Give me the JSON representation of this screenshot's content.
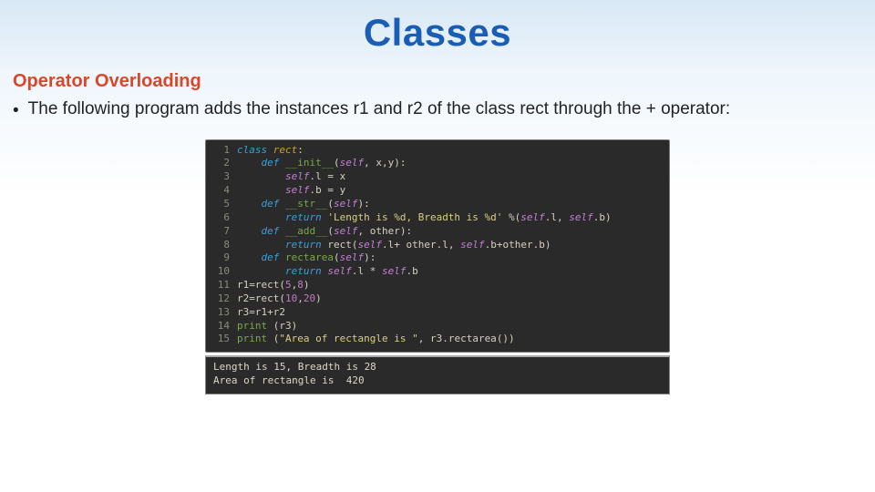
{
  "title": "Classes",
  "subheading": "Operator Overloading",
  "bullet": "The following program adds the instances r1 and r2 of the class rect through the + operator:",
  "code": {
    "lines": [
      {
        "n": "1",
        "tokens": [
          {
            "c": "kw",
            "t": "class"
          },
          {
            "c": "op",
            "t": " "
          },
          {
            "c": "def",
            "t": "rect"
          },
          {
            "c": "op",
            "t": ":"
          }
        ]
      },
      {
        "n": "2",
        "tokens": [
          {
            "c": "op",
            "t": "    "
          },
          {
            "c": "kw",
            "t": "def"
          },
          {
            "c": "op",
            "t": " "
          },
          {
            "c": "fn",
            "t": "__init__"
          },
          {
            "c": "op",
            "t": "("
          },
          {
            "c": "self",
            "t": "self"
          },
          {
            "c": "op",
            "t": ", "
          },
          {
            "c": "id",
            "t": "x"
          },
          {
            "c": "op",
            "t": ","
          },
          {
            "c": "id",
            "t": "y"
          },
          {
            "c": "op",
            "t": "):"
          }
        ]
      },
      {
        "n": "3",
        "tokens": [
          {
            "c": "op",
            "t": "        "
          },
          {
            "c": "self",
            "t": "self"
          },
          {
            "c": "op",
            "t": "."
          },
          {
            "c": "attr",
            "t": "l"
          },
          {
            "c": "op",
            "t": " = "
          },
          {
            "c": "id",
            "t": "x"
          }
        ]
      },
      {
        "n": "4",
        "tokens": [
          {
            "c": "op",
            "t": "        "
          },
          {
            "c": "self",
            "t": "self"
          },
          {
            "c": "op",
            "t": "."
          },
          {
            "c": "attr",
            "t": "b"
          },
          {
            "c": "op",
            "t": " = "
          },
          {
            "c": "id",
            "t": "y"
          }
        ]
      },
      {
        "n": "5",
        "tokens": [
          {
            "c": "op",
            "t": "    "
          },
          {
            "c": "kw",
            "t": "def"
          },
          {
            "c": "op",
            "t": " "
          },
          {
            "c": "fn",
            "t": "__str__"
          },
          {
            "c": "op",
            "t": "("
          },
          {
            "c": "self",
            "t": "self"
          },
          {
            "c": "op",
            "t": "):"
          }
        ]
      },
      {
        "n": "6",
        "tokens": [
          {
            "c": "op",
            "t": "        "
          },
          {
            "c": "kw",
            "t": "return"
          },
          {
            "c": "op",
            "t": " "
          },
          {
            "c": "str",
            "t": "'Length is %d, Breadth is %d'"
          },
          {
            "c": "op",
            "t": " %("
          },
          {
            "c": "self",
            "t": "self"
          },
          {
            "c": "op",
            "t": "."
          },
          {
            "c": "attr",
            "t": "l"
          },
          {
            "c": "op",
            "t": ", "
          },
          {
            "c": "self",
            "t": "self"
          },
          {
            "c": "op",
            "t": "."
          },
          {
            "c": "attr",
            "t": "b"
          },
          {
            "c": "op",
            "t": ")"
          }
        ]
      },
      {
        "n": "7",
        "tokens": [
          {
            "c": "op",
            "t": "    "
          },
          {
            "c": "kw",
            "t": "def"
          },
          {
            "c": "op",
            "t": " "
          },
          {
            "c": "fn",
            "t": "__add__"
          },
          {
            "c": "op",
            "t": "("
          },
          {
            "c": "self",
            "t": "self"
          },
          {
            "c": "op",
            "t": ", "
          },
          {
            "c": "id",
            "t": "other"
          },
          {
            "c": "op",
            "t": "):"
          }
        ]
      },
      {
        "n": "8",
        "tokens": [
          {
            "c": "op",
            "t": "        "
          },
          {
            "c": "kw",
            "t": "return"
          },
          {
            "c": "op",
            "t": " "
          },
          {
            "c": "id",
            "t": "rect"
          },
          {
            "c": "op",
            "t": "("
          },
          {
            "c": "self",
            "t": "self"
          },
          {
            "c": "op",
            "t": "."
          },
          {
            "c": "attr",
            "t": "l"
          },
          {
            "c": "op",
            "t": "+ "
          },
          {
            "c": "id",
            "t": "other"
          },
          {
            "c": "op",
            "t": "."
          },
          {
            "c": "attr",
            "t": "l"
          },
          {
            "c": "op",
            "t": ", "
          },
          {
            "c": "self",
            "t": "self"
          },
          {
            "c": "op",
            "t": "."
          },
          {
            "c": "attr",
            "t": "b"
          },
          {
            "c": "op",
            "t": "+"
          },
          {
            "c": "id",
            "t": "other"
          },
          {
            "c": "op",
            "t": "."
          },
          {
            "c": "attr",
            "t": "b"
          },
          {
            "c": "op",
            "t": ")"
          }
        ]
      },
      {
        "n": "9",
        "tokens": [
          {
            "c": "op",
            "t": "    "
          },
          {
            "c": "kw",
            "t": "def"
          },
          {
            "c": "op",
            "t": " "
          },
          {
            "c": "fn",
            "t": "rectarea"
          },
          {
            "c": "op",
            "t": "("
          },
          {
            "c": "self",
            "t": "self"
          },
          {
            "c": "op",
            "t": "):"
          }
        ]
      },
      {
        "n": "10",
        "tokens": [
          {
            "c": "op",
            "t": "        "
          },
          {
            "c": "kw",
            "t": "return"
          },
          {
            "c": "op",
            "t": " "
          },
          {
            "c": "self",
            "t": "self"
          },
          {
            "c": "op",
            "t": "."
          },
          {
            "c": "attr",
            "t": "l"
          },
          {
            "c": "op",
            "t": " * "
          },
          {
            "c": "self",
            "t": "self"
          },
          {
            "c": "op",
            "t": "."
          },
          {
            "c": "attr",
            "t": "b"
          }
        ]
      },
      {
        "n": "11",
        "tokens": [
          {
            "c": "id",
            "t": "r1"
          },
          {
            "c": "op",
            "t": "="
          },
          {
            "c": "id",
            "t": "rect"
          },
          {
            "c": "op",
            "t": "("
          },
          {
            "c": "num",
            "t": "5"
          },
          {
            "c": "op",
            "t": ","
          },
          {
            "c": "num",
            "t": "8"
          },
          {
            "c": "op",
            "t": ")"
          }
        ]
      },
      {
        "n": "12",
        "tokens": [
          {
            "c": "id",
            "t": "r2"
          },
          {
            "c": "op",
            "t": "="
          },
          {
            "c": "id",
            "t": "rect"
          },
          {
            "c": "op",
            "t": "("
          },
          {
            "c": "num",
            "t": "10"
          },
          {
            "c": "op",
            "t": ","
          },
          {
            "c": "num",
            "t": "20"
          },
          {
            "c": "op",
            "t": ")"
          }
        ]
      },
      {
        "n": "13",
        "tokens": [
          {
            "c": "id",
            "t": "r3"
          },
          {
            "c": "op",
            "t": "="
          },
          {
            "c": "id",
            "t": "r1"
          },
          {
            "c": "op",
            "t": "+"
          },
          {
            "c": "id",
            "t": "r2"
          }
        ]
      },
      {
        "n": "14",
        "tokens": [
          {
            "c": "fn",
            "t": "print"
          },
          {
            "c": "op",
            "t": " ("
          },
          {
            "c": "id",
            "t": "r3"
          },
          {
            "c": "op",
            "t": ")"
          }
        ]
      },
      {
        "n": "15",
        "tokens": [
          {
            "c": "fn",
            "t": "print"
          },
          {
            "c": "op",
            "t": " ("
          },
          {
            "c": "str",
            "t": "\"Area of rectangle is \""
          },
          {
            "c": "op",
            "t": ", "
          },
          {
            "c": "id",
            "t": "r3"
          },
          {
            "c": "op",
            "t": "."
          },
          {
            "c": "attr",
            "t": "rectarea"
          },
          {
            "c": "op",
            "t": "())"
          }
        ]
      }
    ]
  },
  "output": "Length is 15, Breadth is 28\nArea of rectangle is  420"
}
